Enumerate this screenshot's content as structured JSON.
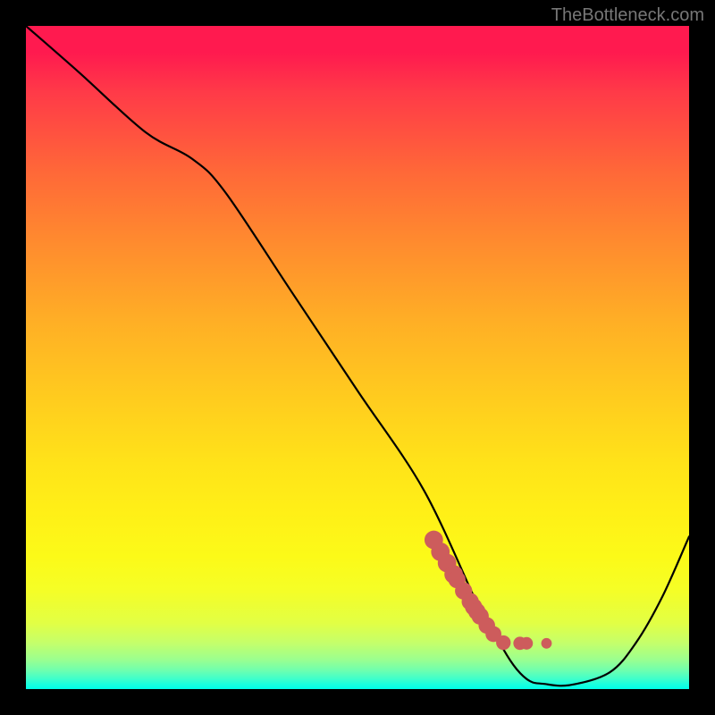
{
  "watermark": "TheBottleneck.com",
  "chart_data": {
    "type": "line",
    "title": "",
    "xlabel": "",
    "ylabel": "",
    "xlim": [
      0,
      100
    ],
    "ylim": [
      0,
      100
    ],
    "grid": false,
    "series": [
      {
        "name": "curve",
        "color": "#000000",
        "x": [
          0,
          8,
          18,
          25,
          30,
          40,
          50,
          60,
          68,
          70,
          72,
          74,
          76,
          78,
          82,
          88,
          92,
          96,
          100
        ],
        "values": [
          100,
          93,
          84,
          80,
          75,
          60,
          45,
          30,
          13,
          10,
          6,
          3,
          1.2,
          0.8,
          0.6,
          2.5,
          7,
          14,
          23
        ]
      },
      {
        "name": "markers",
        "color": "#cd5c5c",
        "x": [
          61.5,
          62.5,
          63.5,
          64.5,
          65.0,
          66.0,
          67.0,
          67.5,
          68.0,
          68.5,
          69.5,
          70.5,
          72.0,
          74.5,
          75.5,
          78.5
        ],
        "values": [
          22.5,
          20.7,
          19.0,
          17.3,
          16.5,
          14.8,
          13.2,
          12.4,
          11.7,
          11.0,
          9.6,
          8.3,
          7.0,
          6.9,
          6.9,
          6.9
        ],
        "size": [
          1.4,
          1.4,
          1.4,
          1.4,
          1.3,
          1.3,
          1.3,
          1.3,
          1.3,
          1.3,
          1.25,
          1.2,
          1.1,
          1.0,
          0.95,
          0.8
        ]
      }
    ]
  }
}
